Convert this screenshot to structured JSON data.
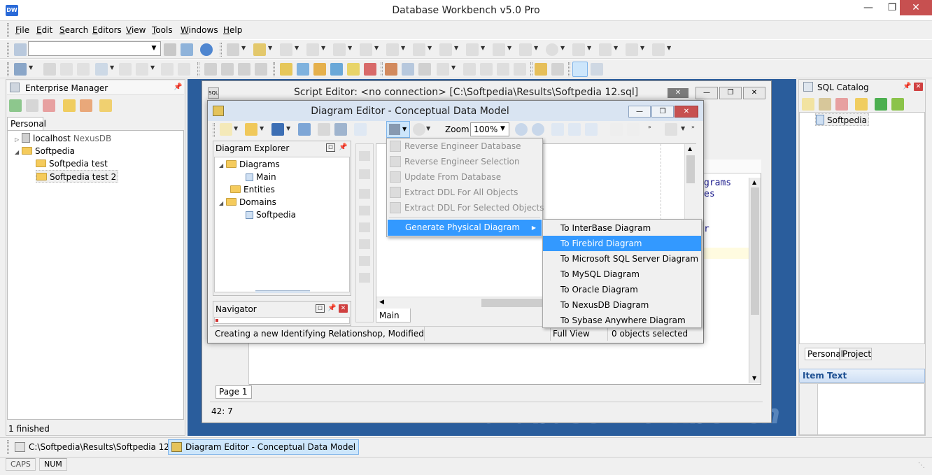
{
  "window": {
    "title": "Database Workbench v5.0 Pro",
    "app_icon_text": "DW"
  },
  "menu": [
    "File",
    "Edit",
    "Search",
    "Editors",
    "View",
    "Tools",
    "Windows",
    "Help"
  ],
  "left_panel": {
    "title": "Enterprise Manager",
    "tab": "Personal",
    "tree": [
      {
        "label": "localhost",
        "extra": "NexusDB"
      },
      {
        "label": "Softpedia"
      },
      {
        "label": "Softpedia test"
      },
      {
        "label": "Softpedia test 2"
      }
    ],
    "status": "1 finished"
  },
  "script_editor": {
    "title": "Script Editor: <no connection>  [C:\\Softpedia\\Results\\Softpedia 12.sql]",
    "code_frag_1": "grams",
    "code_frag_2": "es",
    "code_frag_3": "r",
    "page_tab": "Page 1",
    "cursor_pos": "42:  7"
  },
  "diagram_editor": {
    "title": "Diagram Editor - Conceptual Data Model",
    "zoom_label": "Zoom",
    "zoom_value": "100%",
    "explorer_title": "Diagram Explorer",
    "explorer_tree": {
      "diagrams": "Diagrams",
      "main": "Main",
      "entities": "Entities",
      "domains": "Domains",
      "softpedia": "Softpedia"
    },
    "navigator_title": "Navigator",
    "canvas_tab": "Main",
    "status_main": "Creating a new Identifying Relationshop, Modified",
    "status_view": "Full View",
    "status_selected": "0 objects selected"
  },
  "popup_menu": {
    "items": [
      "Reverse Engineer Database",
      "Reverse Engineer Selection",
      "Update From Database",
      "Extract DDL For All Objects",
      "Extract DDL For Selected Objects"
    ],
    "active_item": "Generate Physical Diagram"
  },
  "submenu": {
    "items": [
      "To InterBase Diagram",
      "To Firebird Diagram",
      "To Microsoft SQL Server Diagram",
      "To MySQL Diagram",
      "To Oracle Diagram",
      "To NexusDB Diagram",
      "To Sybase Anywhere Diagram"
    ],
    "selected_index": 1
  },
  "right_panel": {
    "title": "SQL Catalog",
    "tree_item": "Softpedia",
    "tabs": [
      "Personal",
      "Project"
    ],
    "item_text_title": "Item Text"
  },
  "taskbar": {
    "items": [
      "C:\\Softpedia\\Results\\Softpedia 12.sql",
      "Diagram Editor - Conceptual Data Model"
    ]
  },
  "statusbar": {
    "caps": "CAPS",
    "num": "NUM"
  },
  "watermark": "Database Workbench",
  "colors": {
    "accent": "#3399ff",
    "mdi_background": "#2a5d9c",
    "close_red": "#c75050"
  }
}
